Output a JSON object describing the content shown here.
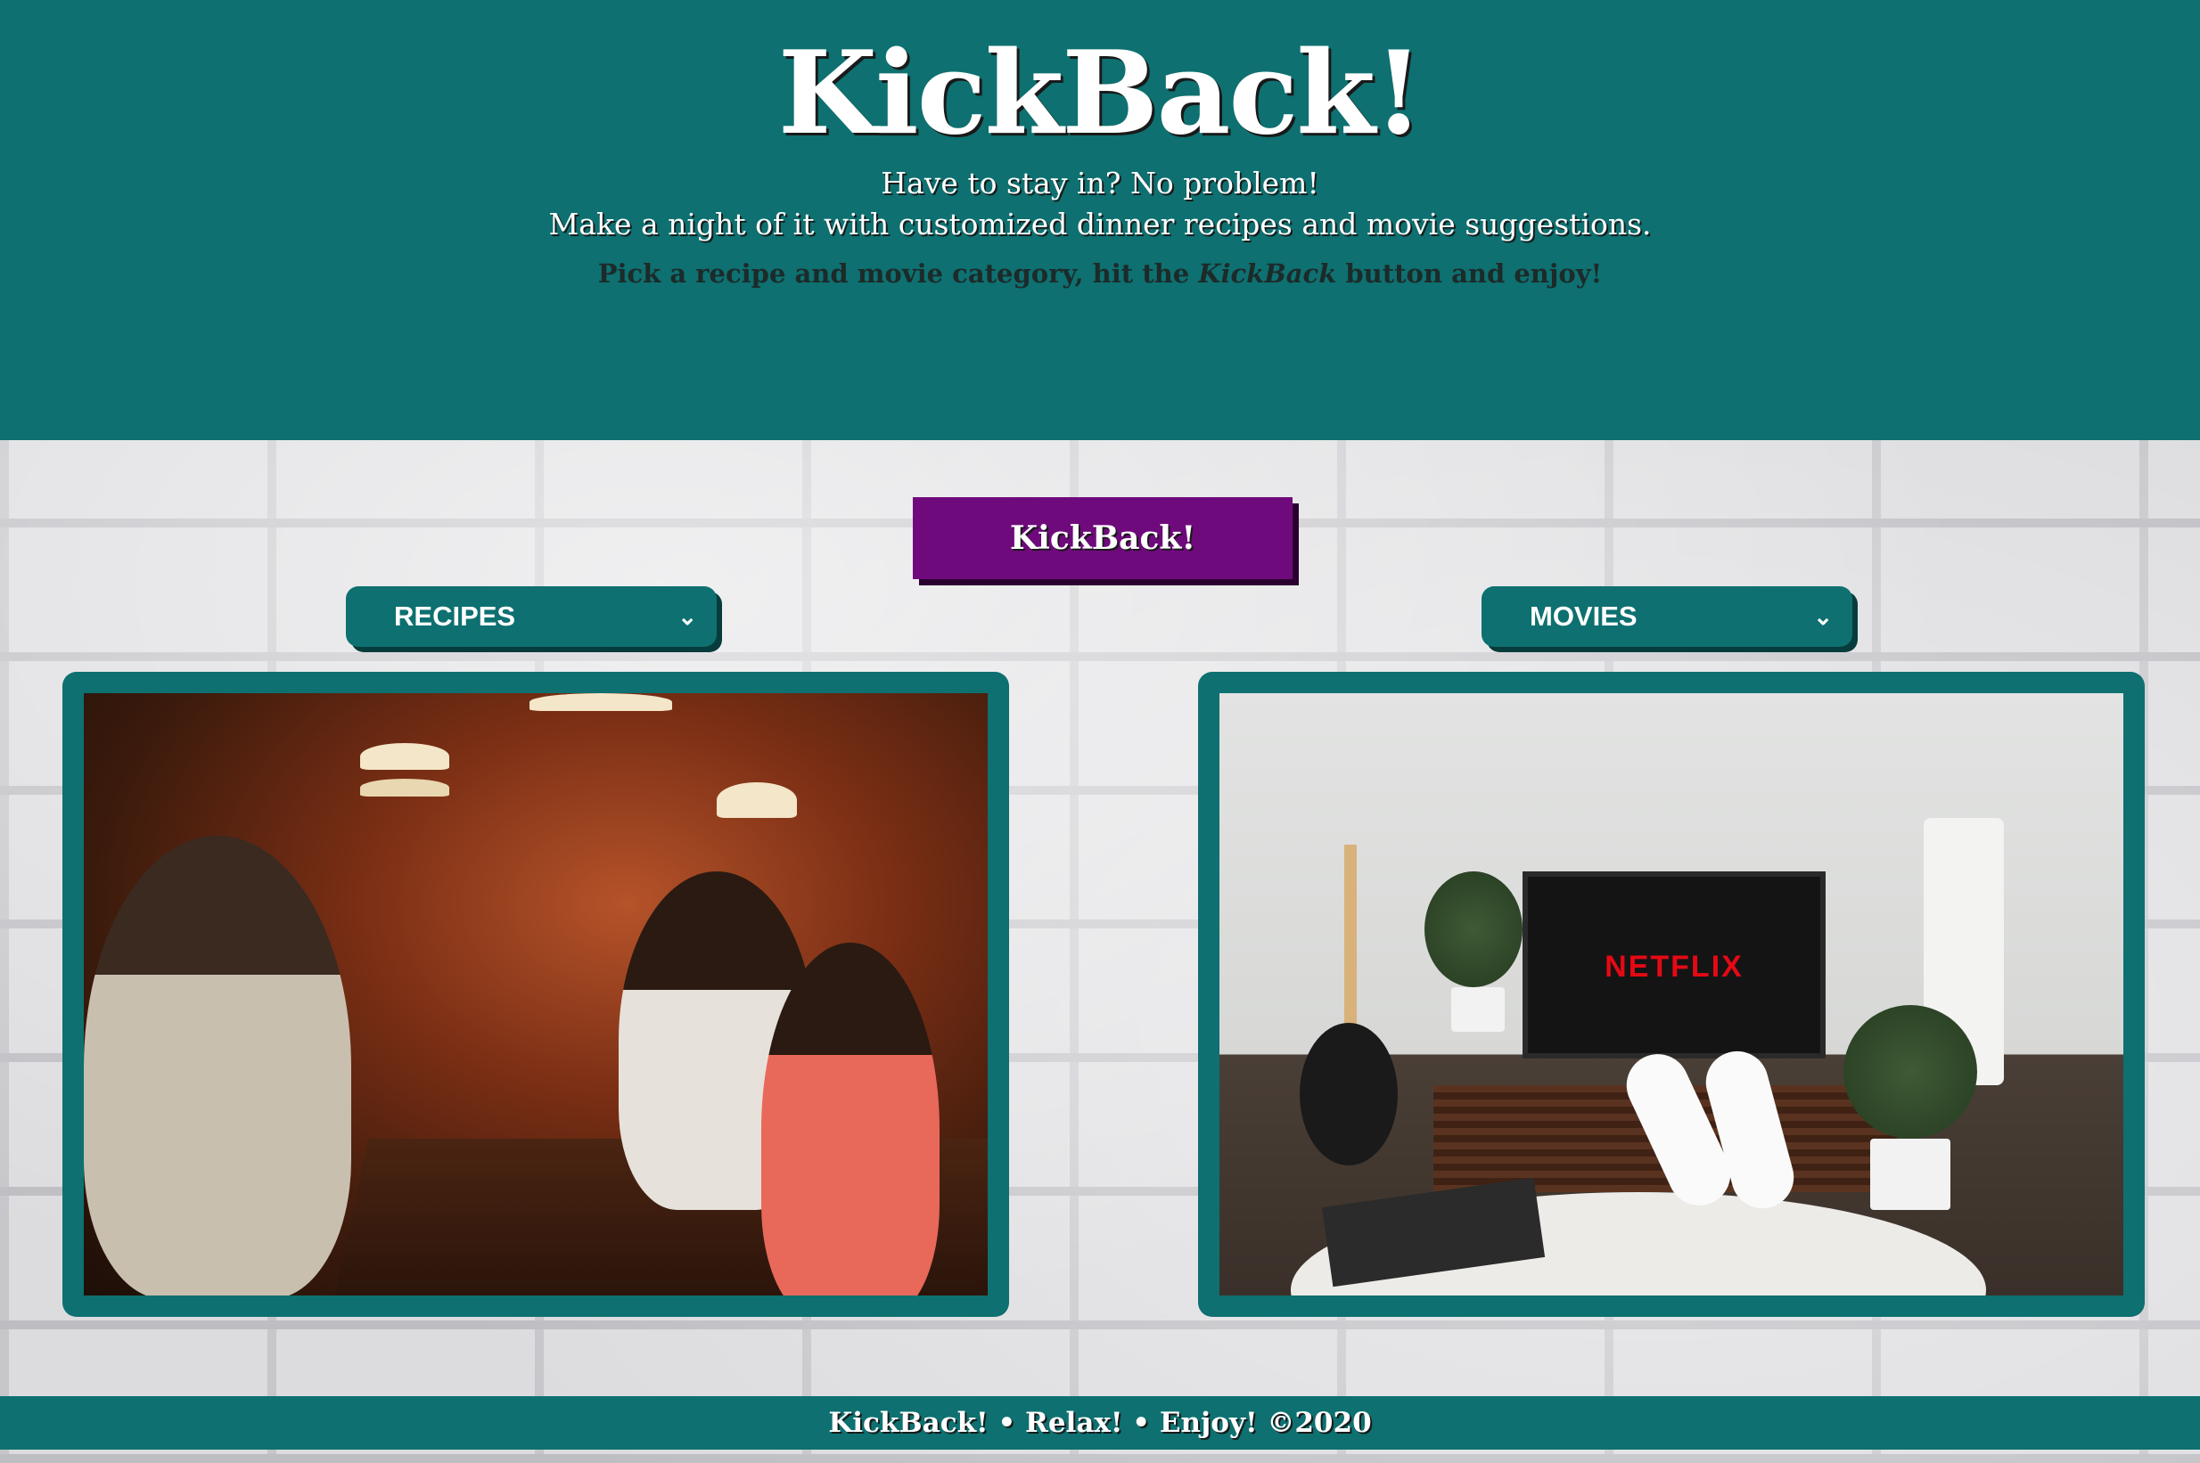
{
  "header": {
    "logo": "KickBack!",
    "tagline_line1": "Have to stay in? No problem!",
    "tagline_line2": "Make a night of it with customized dinner recipes and movie suggestions.",
    "instructions_before": "Pick a recipe and movie category, hit the ",
    "instructions_brand": "KickBack",
    "instructions_after": " button and enjoy!"
  },
  "main": {
    "kickback_button_label": "KickBack!",
    "recipes_select": {
      "selected": "RECIPES",
      "icon": "chevron-down-icon"
    },
    "movies_select": {
      "selected": "MOVIES",
      "icon": "chevron-down-icon"
    },
    "movies_photo": {
      "tv_text": "NETFLIX"
    }
  },
  "footer": {
    "text": "KickBack! • Relax! • Enjoy! ©2020"
  },
  "colors": {
    "teal": "#0e7070",
    "purple_button": "#6f0a7c",
    "white": "#ffffff"
  }
}
